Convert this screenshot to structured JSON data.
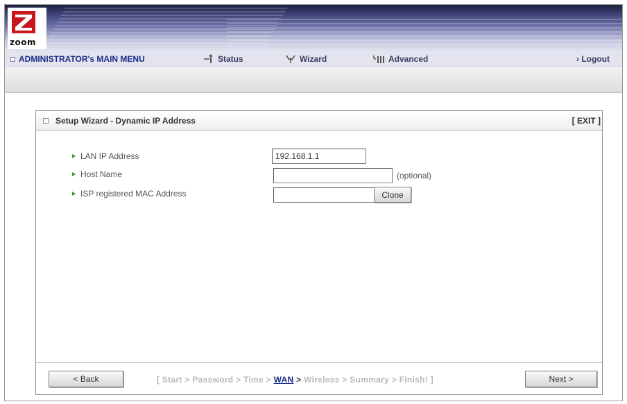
{
  "brand": {
    "logo_text": "zoom"
  },
  "nav": {
    "main_menu": "ADMINISTRATOR's MAIN MENU",
    "status": "Status",
    "wizard": "Wizard",
    "advanced": "Advanced",
    "logout": "› Logout"
  },
  "panel": {
    "title": "Setup Wizard - Dynamic IP Address",
    "exit": "[ EXIT ]"
  },
  "form": {
    "lan_ip": {
      "label": "LAN IP Address",
      "value": "192.168.1.1"
    },
    "host_name": {
      "label": "Host Name",
      "value": "",
      "hint": "(optional)"
    },
    "mac": {
      "label": "ISP registered MAC Address",
      "value": "",
      "button": "Clone"
    }
  },
  "footer": {
    "back": "< Back",
    "next": "Next >",
    "steps_before": "[ Start > Password > Time > ",
    "step_current": "WAN",
    "steps_sep": " > ",
    "steps_after": "Wireless > Summary > Finish! ]"
  },
  "colors": {
    "brand_red": "#c8161d",
    "nav_blue": "#1c2c8a",
    "bullet_green": "#2f9a3a"
  }
}
